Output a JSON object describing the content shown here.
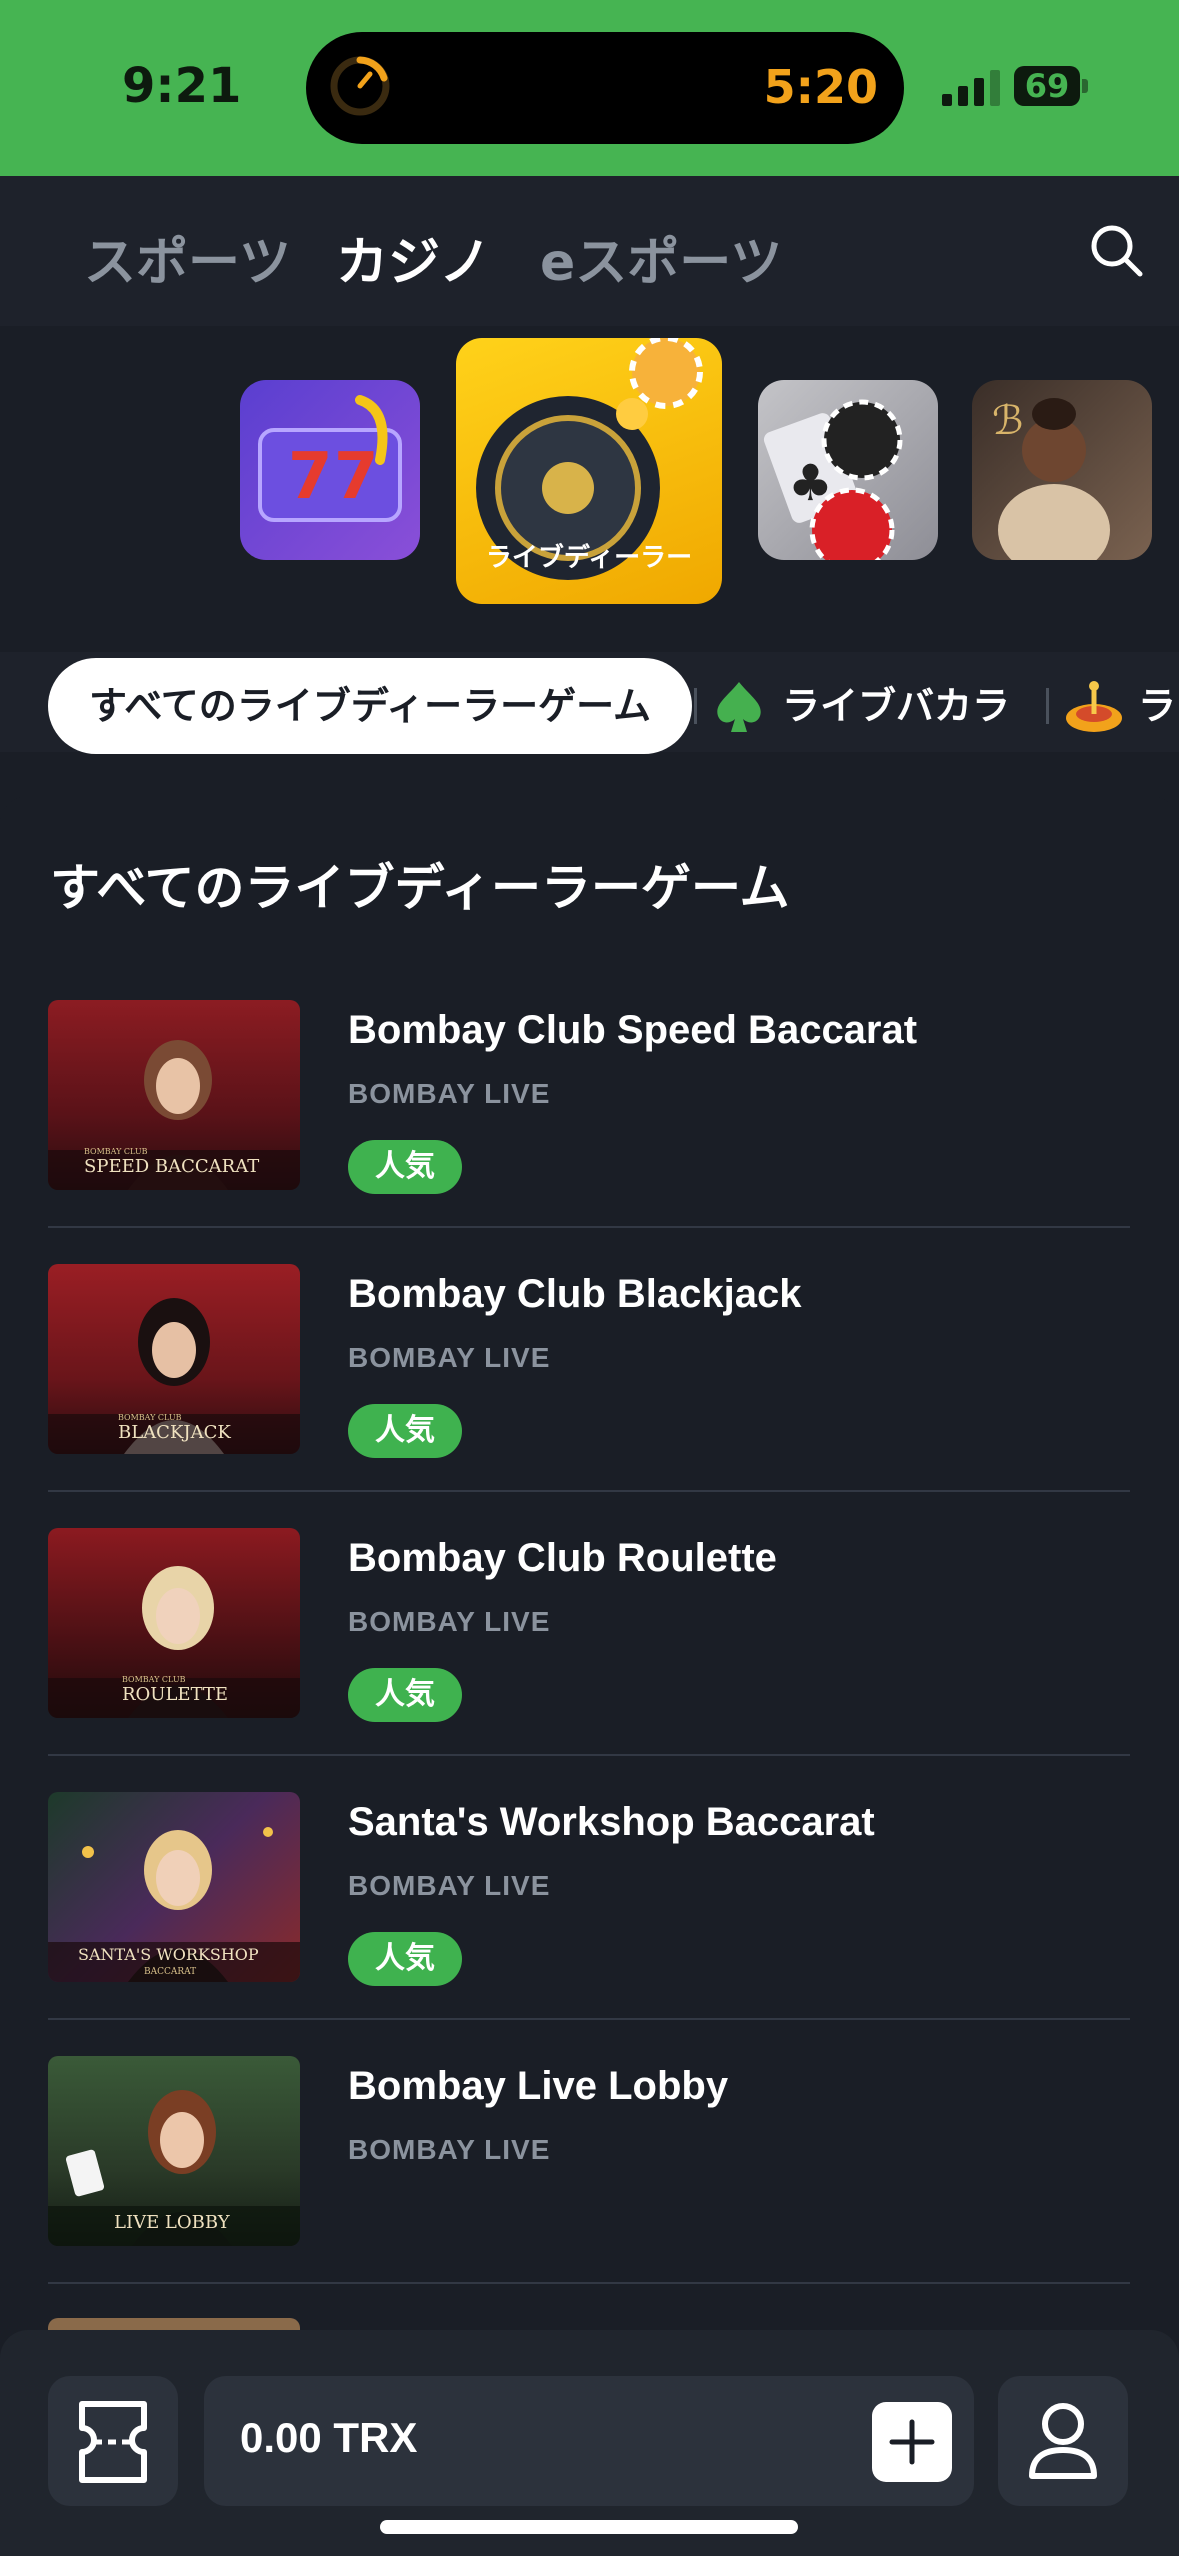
{
  "status_bar": {
    "time": "9:21",
    "timer": "5:20",
    "battery": "69"
  },
  "top_tabs": [
    {
      "label": "スポーツ"
    },
    {
      "label": "カジノ"
    },
    {
      "label": "eスポーツ"
    }
  ],
  "categories": [
    {
      "icon": "slot-machine-icon"
    },
    {
      "label": "ライブディーラー",
      "icon": "roulette-icon"
    },
    {
      "icon": "poker-chips-icon"
    },
    {
      "icon": "live-dealer-woman-icon"
    }
  ],
  "filters": {
    "active": "すべてのライブディーラーゲーム",
    "items": [
      {
        "label": "ライブバカラ",
        "icon": "spade-icon"
      },
      {
        "label": "ラ",
        "icon": "roulette-icon"
      }
    ]
  },
  "section_title": "すべてのライブディーラーゲーム",
  "games": [
    {
      "name": "Bombay Club Speed Baccarat",
      "provider": "BOMBAY LIVE",
      "badge": "人気",
      "thumb_caption": "SPEED BACCARAT",
      "thumb_brand": "BOMBAY CLUB"
    },
    {
      "name": "Bombay Club Blackjack",
      "provider": "BOMBAY LIVE",
      "badge": "人気",
      "thumb_caption": "BLACKJACK",
      "thumb_brand": "BOMBAY CLUB"
    },
    {
      "name": "Bombay Club Roulette",
      "provider": "BOMBAY LIVE",
      "badge": "人気",
      "thumb_caption": "ROULETTE",
      "thumb_brand": "BOMBAY CLUB"
    },
    {
      "name": "Santa's Workshop Baccarat",
      "provider": "BOMBAY LIVE",
      "badge": "人気",
      "thumb_caption": "SANTA'S WORKSHOP",
      "thumb_sub": "BACCARAT"
    },
    {
      "name": "Bombay Live Lobby",
      "provider": "BOMBAY LIVE",
      "thumb_caption": "LIVE LOBBY"
    }
  ],
  "bottom_bar": {
    "balance": "0.00 TRX"
  },
  "colors": {
    "brand_green": "#46b452",
    "badge_green": "#3fb24f",
    "bg": "#1a1e26",
    "timer_orange": "#f2a21b"
  }
}
